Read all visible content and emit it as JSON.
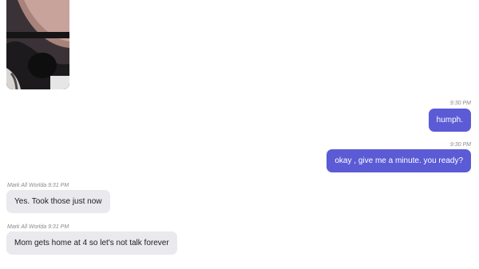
{
  "conversation": {
    "messages": [
      {
        "direction": "outgoing",
        "time": "9:30 PM",
        "text": "humph."
      },
      {
        "direction": "outgoing",
        "time": "9:30 PM",
        "text": "okay , give me a minute. you ready?"
      },
      {
        "direction": "incoming",
        "meta": "Mark All Worlda 9:31 PM",
        "text": "Yes. Took those just now"
      },
      {
        "direction": "incoming",
        "meta": "Mark All Worlda 9:31 PM",
        "text": "Mom gets home at 4 so let's not talk forever"
      }
    ]
  },
  "colors": {
    "outgoing_bubble": "#5b5bd6",
    "incoming_bubble": "#e9e9ee",
    "timestamp": "#8a8a8a"
  }
}
